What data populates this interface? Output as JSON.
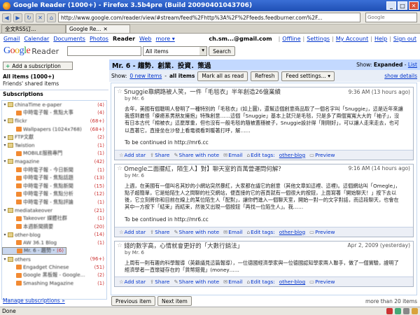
{
  "window": {
    "title": "Google Reader (1000+) - Firefox 3.5b4pre (Build 20090401043706)"
  },
  "browser": {
    "url": "http://www.google.com/reader/view/#stream/feed%2Fhttp%3A%2F%2Ffeeds.feedburner.com%2F...",
    "search_placeholder": "Google",
    "tabs": [
      {
        "label": "全文RSS订..."
      },
      {
        "label": "Google Re..."
      }
    ]
  },
  "gbar": {
    "links": [
      "Gmail",
      "Calendar",
      "Documents",
      "Photos"
    ],
    "current": "Reader",
    "more_links": [
      "Web",
      "more ▾"
    ],
    "user": "ch.sm...@gmail.com",
    "right_links": [
      "Offline",
      "Settings",
      "My Account",
      "Help",
      "Sign out"
    ]
  },
  "header": {
    "logo_g": "G",
    "logo_o1": "o",
    "logo_o2": "o",
    "logo_g2": "g",
    "logo_l": "l",
    "logo_e": "e",
    "reader": "Reader",
    "search_scope": "All items",
    "search_button": "Search"
  },
  "sidebar": {
    "add_subscription": "Add a subscription",
    "all_items": "All items (1000+)",
    "shared_items": "Friends' shared items",
    "subscriptions_header": "Subscriptions",
    "manage": "Manage subscriptions »",
    "items": [
      {
        "label": "chinaTime e-paper",
        "count": "(4)",
        "type": "folder",
        "child": false
      },
      {
        "label": "中時電子報 - 焦點大事",
        "count": "(4)",
        "type": "feed",
        "child": true
      },
      {
        "label": "flickr",
        "count": "(68+)",
        "type": "folder",
        "child": false
      },
      {
        "label": "Wallpapers (1024x768)",
        "count": "(68+)",
        "type": "feed",
        "child": true
      },
      {
        "label": "FTP文獻",
        "count": "(2)",
        "type": "folder",
        "child": false
      },
      {
        "label": "Twistion",
        "count": "(1)",
        "type": "folder",
        "child": false
      },
      {
        "label": "MOBILE服務專門",
        "count": "(1)",
        "type": "feed",
        "child": true
      },
      {
        "label": "magazine",
        "count": "(42)",
        "type": "folder",
        "child": false
      },
      {
        "label": "中時電子報 - 今日新聞",
        "count": "(1)",
        "type": "feed",
        "child": true
      },
      {
        "label": "中時電子報 - 焦點話題",
        "count": "(13)",
        "type": "feed",
        "child": true
      },
      {
        "label": "中時電子報 - 焦點新聞",
        "count": "(15)",
        "type": "feed",
        "child": true
      },
      {
        "label": "中時電子報 - 焦點分析",
        "count": "(12)",
        "type": "feed",
        "child": true
      },
      {
        "label": "中時電子報 - 焦點評論",
        "count": "(1)",
        "type": "feed",
        "child": true
      },
      {
        "label": "mediatakeover",
        "count": "(21)",
        "type": "folder",
        "child": false
      },
      {
        "label": "Takeover 媒體社群",
        "count": "(1)",
        "type": "feed",
        "child": true
      },
      {
        "label": "本週新聞摘要",
        "count": "(20)",
        "type": "feed",
        "child": true
      },
      {
        "label": "other-blog",
        "count": "(14)",
        "type": "folder",
        "child": false
      },
      {
        "label": "AW 36.1 Blog",
        "count": "(1)",
        "type": "feed",
        "child": true
      },
      {
        "label": "Mr. 6 - 趨勢・創業・投資・策",
        "count": "(6)",
        "type": "feed",
        "child": true,
        "selected": true
      },
      {
        "label": "others",
        "count": "(96+)",
        "type": "folder",
        "child": false
      },
      {
        "label": "Engadget Chinese",
        "count": "(51)",
        "type": "feed",
        "child": true
      },
      {
        "label": "Google 黑板報 - Google...",
        "count": "(2)",
        "type": "feed",
        "child": true
      },
      {
        "label": "Smashing Magazine",
        "count": "(1)",
        "type": "feed",
        "child": true
      }
    ]
  },
  "main": {
    "channel_title": "Mr. 6 - 趨勢．創業．投資．策過",
    "show_prefix": "Show:",
    "show_expanded": "Expanded",
    "show_list": "List",
    "toolbar": {
      "show": "Show:",
      "new_items": "0 new items",
      "all_items": "all items",
      "mark_all_read": "Mark all as read",
      "refresh": "Refresh",
      "feed_settings": "Feed settings...",
      "show_details": "show details"
    },
    "entries": [
      {
        "title": "Snuggie靠網路被人笑，一件「毛毯衣」半年創造26億業績",
        "date": "9:36 AM (13 hours ago)",
        "author": "by Mr. 6",
        "body": "去年，美國有個聰明人發明了一種特別的「毛毯衣」(如上圖)，還幫這個創意商品取了一個名字叫「Snuggie」，這是近年來讓我感到最怪「療癒系男朋友擁抱」特殊創意……這個「Snuggie」基本上就只是毛毯，只是多了兩個寬寬大大的「袖子」，沒有日本古代「棉被衣」這麼厚重，但也沒有一般毛毯的隨被蓋穩被子，Snuggie設計得「剛剛好」，可以讓人走來走去，也可以直著它，直接坐在沙發上看電視看到暖著打呼，解……",
        "continued": "To be continued in http://mr6.cc",
        "actions": {
          "star": "Add star",
          "share": "Share",
          "share_note": "Share with note",
          "email": "Email",
          "edit_tags": "Edit tags:",
          "tag": "other-blog",
          "preview": "Preview"
        }
      },
      {
        "title": "Omegle二面擺紅，陌生人】對】聊天室的百萬營運問何解？",
        "date": "9:16 AM (14 hours ago)",
        "author": "by Mr. 6",
        "body": "上週，在美國有一個叫名其妙的小網站突然暴紅，大家都在議它的創意（其他文章如這裡、這裡)。這個網站叫「Omegle」，點子超簡單，它是給陌生人之間聊的社交網站，便直接的它的首頁就有一個很大的按鈕，上面寫著「開始聊天！」按下去以後，它立刻將你和目前在線上的某位陌生人「配對」，讓你們進入一個聊天室，開始一對一的文字對話，而這段聊天，也會在其中一方按下「結束」而結束，然後又出現一個按鈕「再找一位陌生人」。我……",
        "continued": "To be continued in http://mr6.cc",
        "actions": {
          "star": "Add star",
          "share": "Share",
          "share_note": "Share with note",
          "email": "Email",
          "edit_tags": "Edit tags:",
          "tag": "other-blog",
          "preview": "Preview"
        }
      },
      {
        "title": "錢的數字高，心情就會更好的「大數行銷法」",
        "date": "Apr 2, 2009 (yesterday)",
        "author": "by Mr. 6",
        "body": "上周有一則有趣的科學報導（英籍議見這篇報導），一位德國經濟學家與一位德國認知學家兩人聯手，做了一個實驗，證明了經濟學者一直懷疑存在的「貨幣錯覺」(money……",
        "continued": "",
        "actions": {
          "star": "Add star",
          "share": "Share",
          "share_note": "Share with note",
          "email": "Email",
          "edit_tags": "Edit tags:",
          "tag": "other-blog",
          "preview": "Preview"
        }
      }
    ],
    "previous_item": "Previous item",
    "next_item": "Next item",
    "more_than": "more than 20 items"
  },
  "status": {
    "text": "Done"
  },
  "colors": {
    "accent": "#c3d9ff",
    "link": "#0033cc",
    "count": "#cc3333"
  }
}
